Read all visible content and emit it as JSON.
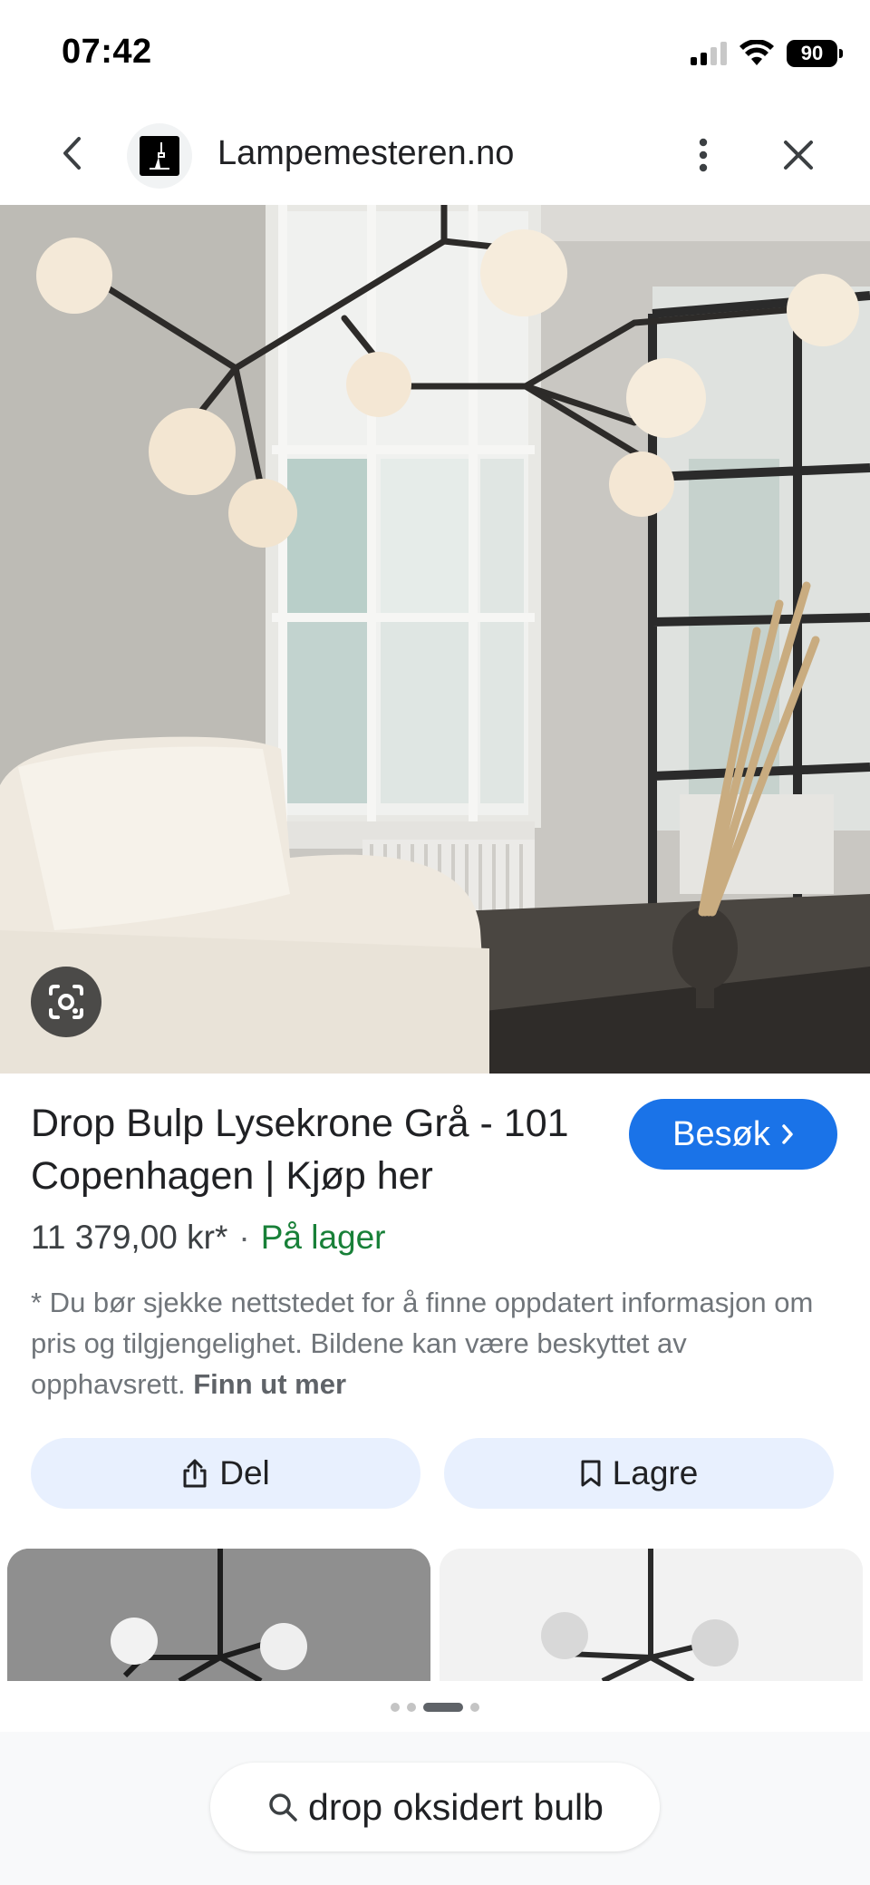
{
  "status_bar": {
    "time": "07:42",
    "battery": "90",
    "icons": [
      "signal-icon",
      "wifi-icon",
      "battery-icon"
    ]
  },
  "header": {
    "site_name": "Lampemesteren.no",
    "icons": [
      "back-arrow-icon",
      "site-favicon",
      "more-vertical-icon",
      "close-icon"
    ]
  },
  "product": {
    "title": "Drop Bulp Lysekrone Grå - 101 Copenhagen | Kjøp her",
    "visit_label": "Besøk",
    "price": "11 379,00 kr*",
    "separator": "·",
    "stock": "På lager",
    "disclaimer": "* Du bør sjekke nettstedet for å finne oppdatert informasjon om pris og tilgjengelighet. Bildene kan være beskyttet av opphavsrett.",
    "learn_more": "Finn ut mer"
  },
  "actions": {
    "share_label": "Del",
    "save_label": "Lagre"
  },
  "carousel": {
    "pages": 4,
    "active_index": 2
  },
  "search": {
    "query": "drop oksidert bulb"
  },
  "colors": {
    "accent_blue": "#1a73e8",
    "stock_green": "#188038",
    "action_bg": "#e8f0fe"
  }
}
